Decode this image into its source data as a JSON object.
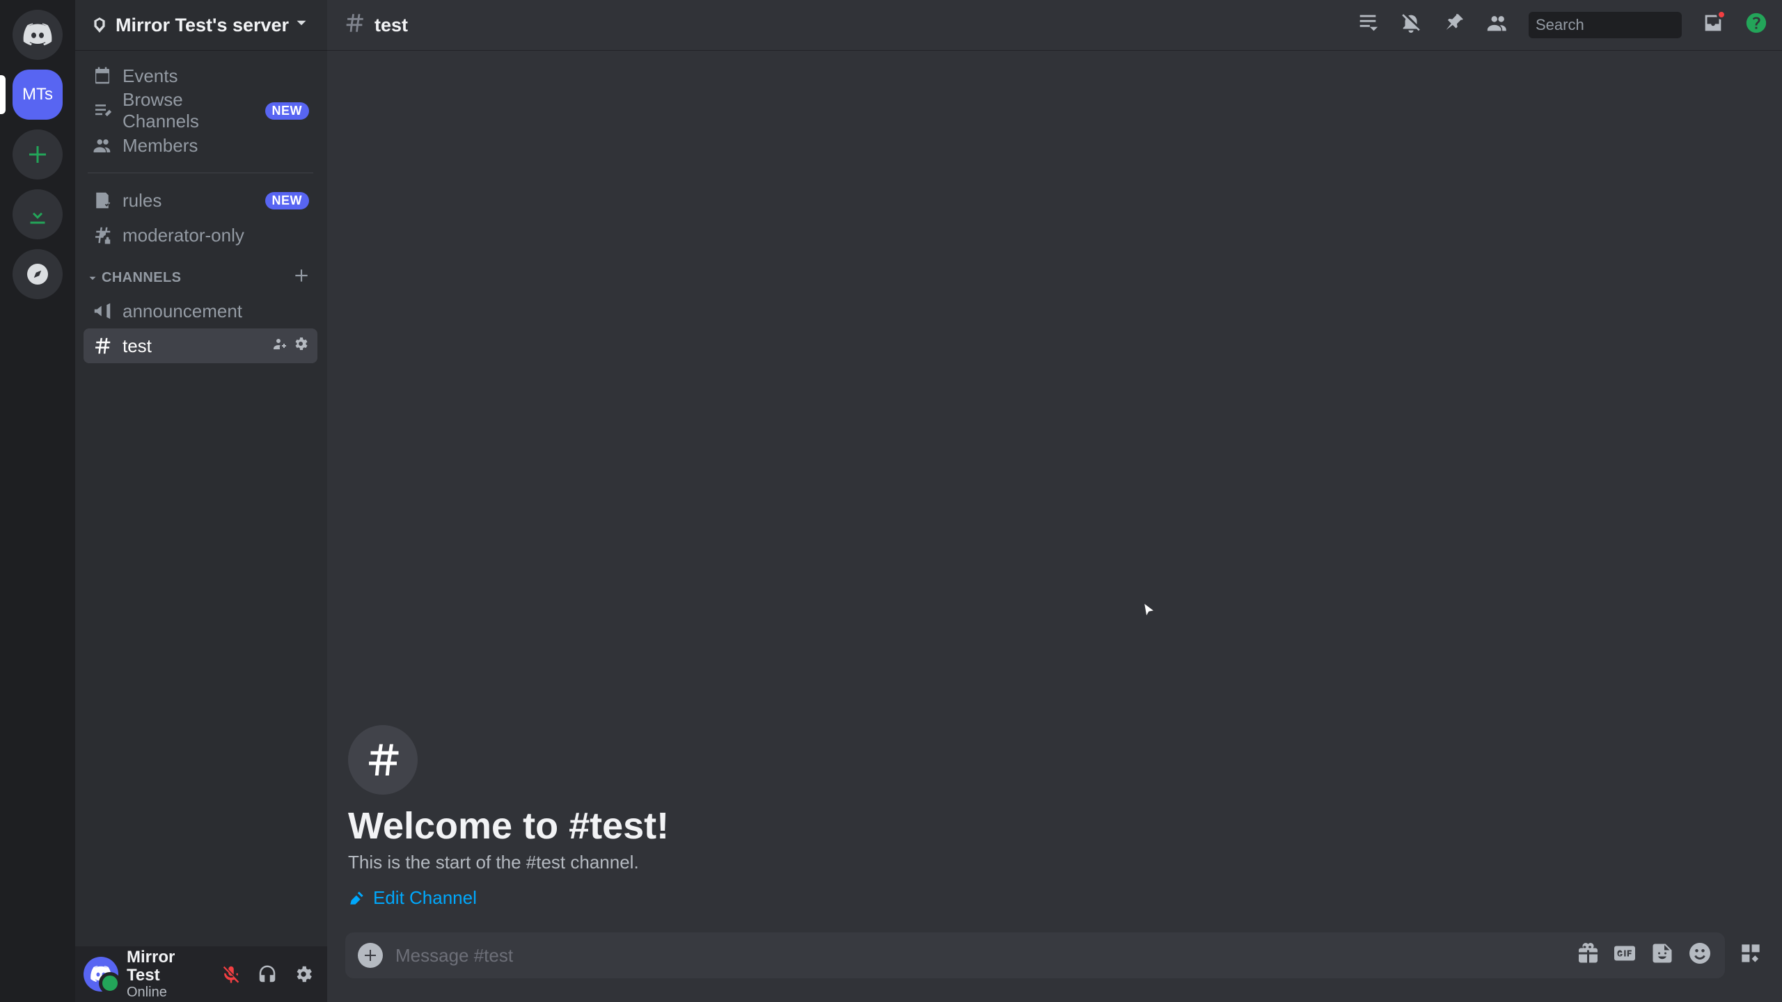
{
  "guild_rail": {
    "selected_initials": "MTs"
  },
  "server": {
    "name": "Mirror Test's server"
  },
  "sidebar": {
    "events_label": "Events",
    "browse_label": "Browse Channels",
    "browse_badge": "NEW",
    "members_label": "Members",
    "rules_label": "rules",
    "rules_badge": "NEW",
    "moderator_label": "moderator-only",
    "category_label": "CHANNELS",
    "channels": [
      {
        "name": "announcement",
        "type": "announcement"
      },
      {
        "name": "test",
        "type": "text",
        "active": true
      }
    ]
  },
  "header": {
    "channel_name": "test",
    "search_placeholder": "Search"
  },
  "welcome": {
    "title": "Welcome to #test!",
    "subtitle": "This is the start of the #test channel.",
    "edit_label": "Edit Channel"
  },
  "composer": {
    "placeholder": "Message #test"
  },
  "user": {
    "name": "Mirror Test",
    "status": "Online"
  }
}
